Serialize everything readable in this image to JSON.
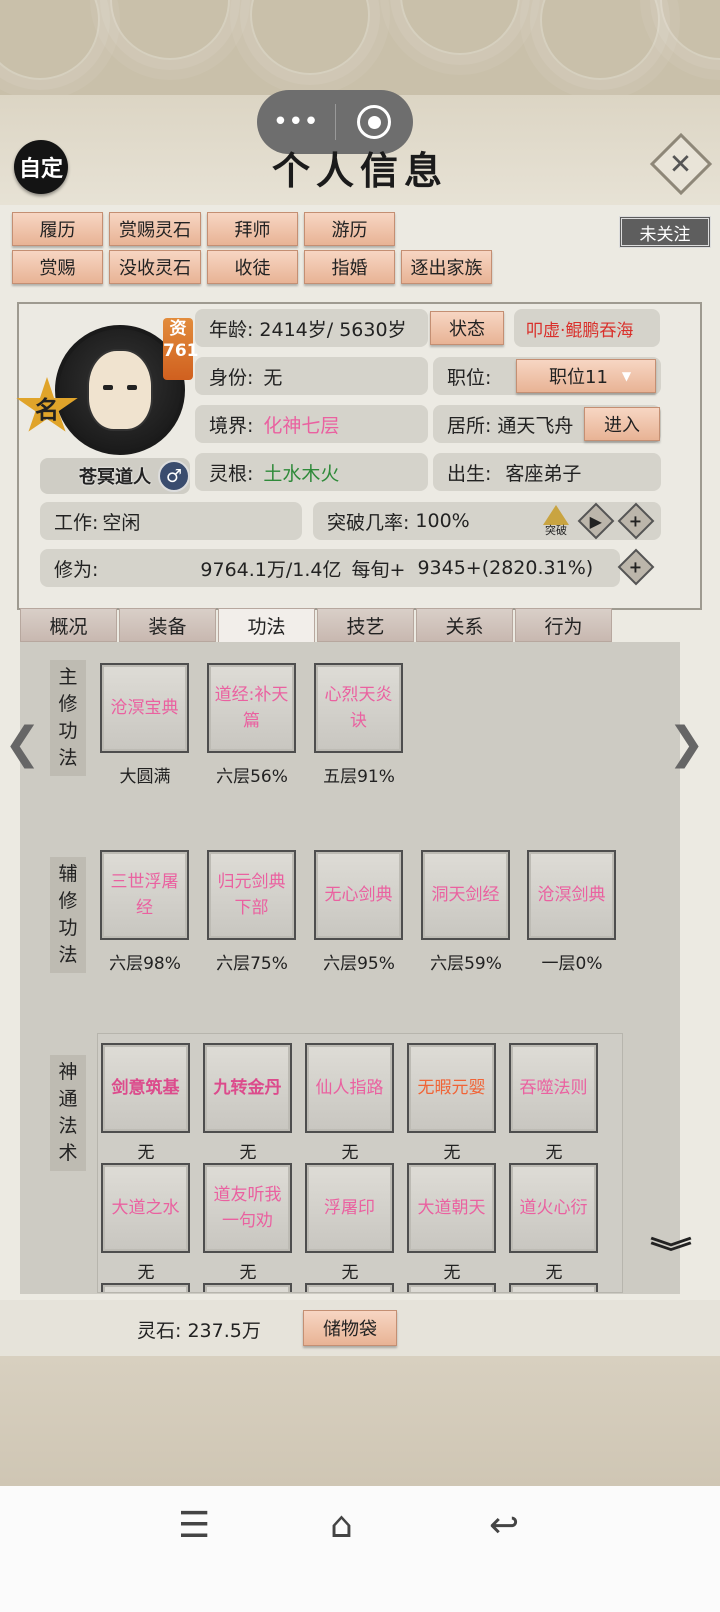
{
  "header": {
    "title": "个人信息",
    "custom_label": "自定",
    "close_icon": "close-icon",
    "follow_label": "未关注"
  },
  "actions": {
    "row1": [
      "履历",
      "赏赐灵石",
      "拜师",
      "游历"
    ],
    "row2": [
      "赏赐",
      "没收灵石",
      "收徒",
      "指婚",
      "逐出家族"
    ]
  },
  "character": {
    "name": "苍冥道人",
    "gender_symbol": "♂",
    "badge_star": "名",
    "aptitude_label": "资",
    "aptitude_value": "761",
    "age_label": "年龄:",
    "age_value": "2414岁/ 5630岁",
    "status_button": "状态",
    "status_text": "叩虚·鲲鹏吞海",
    "identity_label": "身份:",
    "identity_value": "无",
    "position_label": "职位:",
    "position_value": "职位11",
    "realm_label": "境界:",
    "realm_value": "化神七层",
    "residence_label": "居所:",
    "residence_value": "通天飞舟",
    "enter_button": "进入",
    "root_label": "灵根:",
    "root_value": "土水木火",
    "origin_label": "出生:",
    "origin_value": "客座弟子",
    "work_label": "工作:",
    "work_value": "空闲",
    "breakthrough_label": "突破几率:",
    "breakthrough_value": "100%",
    "breakthrough_btn": "突破",
    "cultivation_label": "修为:",
    "cultivation_value": "9764.1万/1.4亿",
    "per_turn_label": "每旬+",
    "per_turn_value": "9345+(2820.31%)"
  },
  "tabs": [
    "概况",
    "装备",
    "功法",
    "技艺",
    "关系",
    "行为"
  ],
  "active_tab": "功法",
  "sections": {
    "main": {
      "label": "主修功法",
      "chars": [
        "主",
        "修",
        "功",
        "法"
      ]
    },
    "aux": {
      "label": "辅修功法",
      "chars": [
        "辅",
        "修",
        "功",
        "法"
      ]
    },
    "skills": {
      "label": "神通法术",
      "chars": [
        "神",
        "通",
        "法",
        "术"
      ]
    }
  },
  "main_techniques": [
    {
      "name": "沧溟宝典",
      "level": "大圆满"
    },
    {
      "name": "道经:补天篇",
      "level": "六层56%"
    },
    {
      "name": "心烈天炎诀",
      "level": "五层91%"
    }
  ],
  "aux_techniques": [
    {
      "name": "三世浮屠经",
      "level": "六层98%"
    },
    {
      "name": "归元剑典下部",
      "level": "六层75%"
    },
    {
      "name": "无心剑典",
      "level": "六层95%"
    },
    {
      "name": "洞天剑经",
      "level": "六层59%"
    },
    {
      "name": "沧溟剑典",
      "level": "一层0%"
    }
  ],
  "spells_row1": [
    {
      "name": "剑意筑基",
      "level": "无"
    },
    {
      "name": "九转金丹",
      "level": "无"
    },
    {
      "name": "仙人指路",
      "level": "无"
    },
    {
      "name": "无暇元婴",
      "level": "无"
    },
    {
      "name": "吞噬法则",
      "level": "无"
    }
  ],
  "spells_row2": [
    {
      "name": "大道之水",
      "level": "无"
    },
    {
      "name": "道友听我一句劝",
      "level": "无"
    },
    {
      "name": "浮屠印",
      "level": "无"
    },
    {
      "name": "大道朝天",
      "level": "无"
    },
    {
      "name": "道火心衍",
      "level": "无"
    }
  ],
  "footer": {
    "spirit_stone": "灵石: 237.5万",
    "bag_button": "储物袋"
  },
  "colors": {
    "accent_pink": "#ea61a0",
    "accent_red": "#d9302b",
    "accent_green": "#2f8a3a",
    "accent_orange": "#f06437",
    "button_peach": "#f1c6ad"
  }
}
